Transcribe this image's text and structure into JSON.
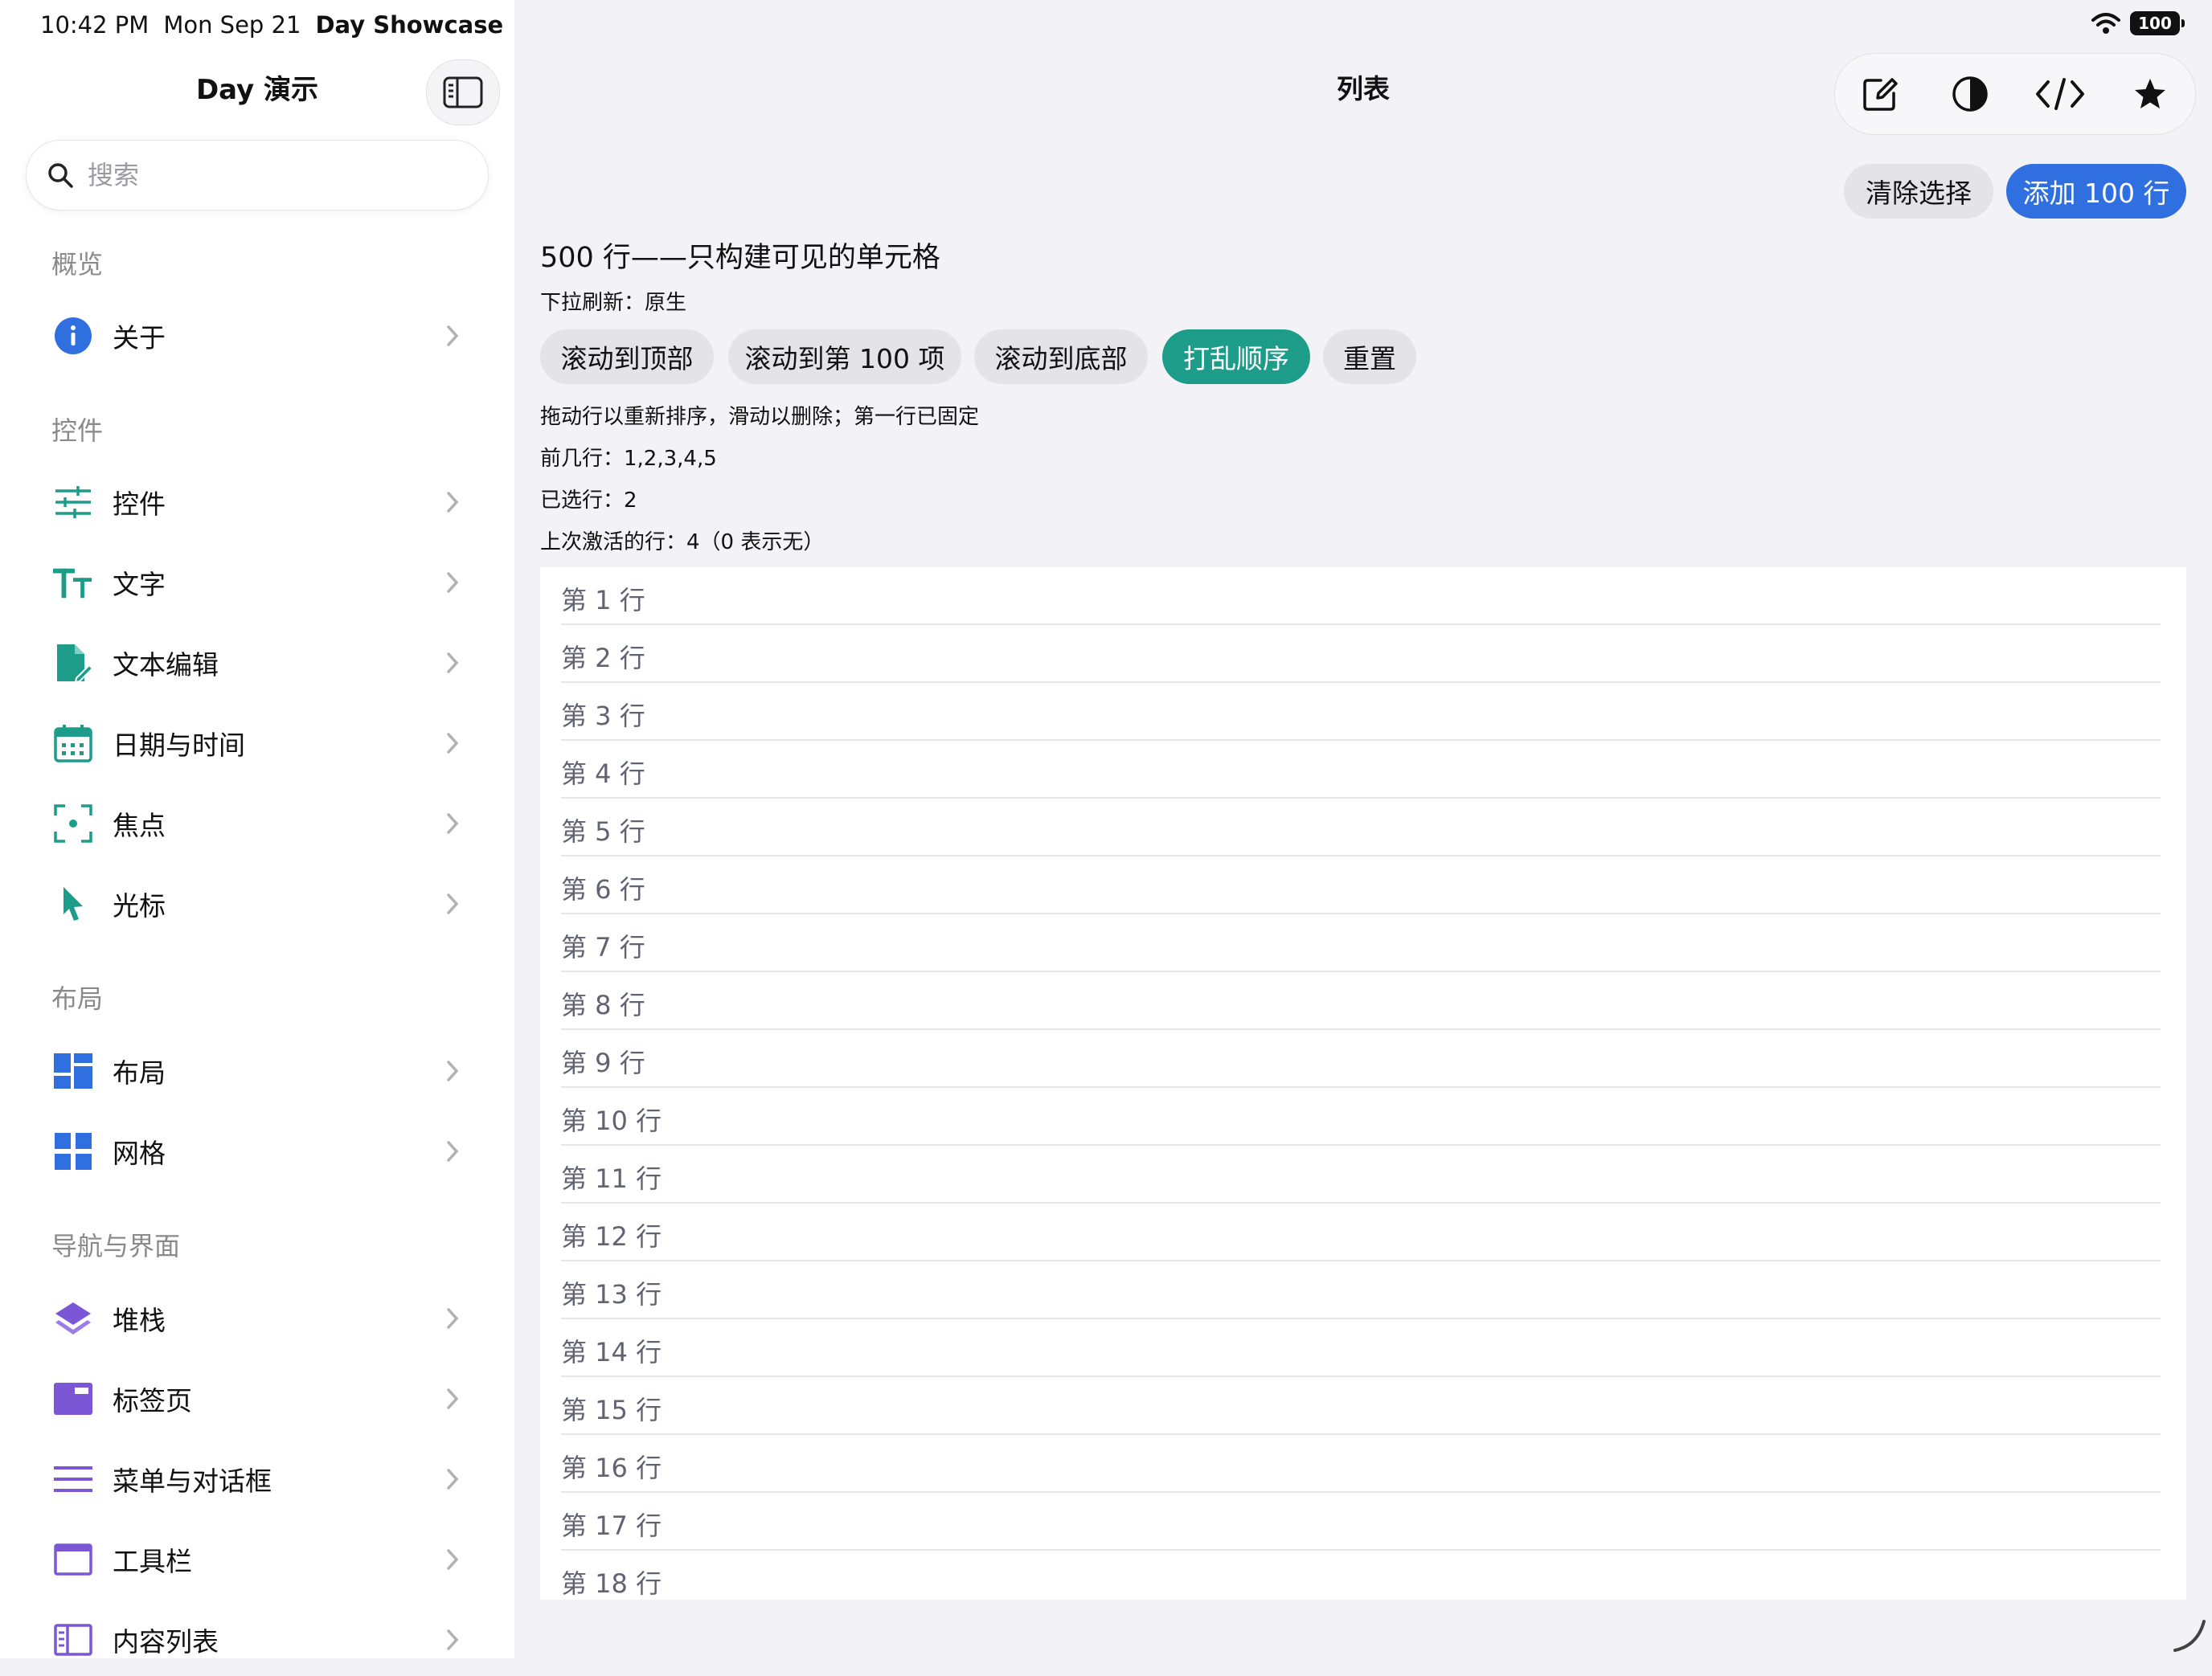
{
  "status": {
    "time": "10:42 PM",
    "date": "Mon Sep 21",
    "app": "Day Showcase",
    "battery": "100"
  },
  "sidebar": {
    "title": "Day 演示",
    "search_placeholder": "搜索",
    "sections": [
      {
        "label": "概览",
        "items": [
          {
            "label": "关于",
            "icon": "info-circle-icon",
            "color": "#2f6fe0"
          }
        ]
      },
      {
        "label": "控件",
        "items": [
          {
            "label": "控件",
            "icon": "sliders-icon",
            "color": "#1e9c8a"
          },
          {
            "label": "文字",
            "icon": "text-size-icon",
            "color": "#1e9c8a"
          },
          {
            "label": "文本编辑",
            "icon": "document-edit-icon",
            "color": "#1e9c8a"
          },
          {
            "label": "日期与时间",
            "icon": "calendar-icon",
            "color": "#1e9c8a"
          },
          {
            "label": "焦点",
            "icon": "focus-icon",
            "color": "#1e9c8a"
          },
          {
            "label": "光标",
            "icon": "cursor-icon",
            "color": "#1e9c8a"
          }
        ]
      },
      {
        "label": "布局",
        "items": [
          {
            "label": "布局",
            "icon": "layout-icon",
            "color": "#2f6fe0"
          },
          {
            "label": "网格",
            "icon": "grid-icon",
            "color": "#2f6fe0"
          }
        ]
      },
      {
        "label": "导航与界面",
        "items": [
          {
            "label": "堆栈",
            "icon": "stack-icon",
            "color": "#7b57d6"
          },
          {
            "label": "标签页",
            "icon": "tabs-icon",
            "color": "#7b57d6"
          },
          {
            "label": "菜单与对话框",
            "icon": "menu-icon",
            "color": "#7b57d6"
          },
          {
            "label": "工具栏",
            "icon": "toolbar-icon",
            "color": "#7b57d6"
          },
          {
            "label": "内容列表",
            "icon": "content-list-icon",
            "color": "#7b57d6"
          }
        ]
      }
    ]
  },
  "main": {
    "title": "列表",
    "toolbar_icons": [
      "compose-icon",
      "contrast-icon",
      "code-icon",
      "star-icon"
    ],
    "clear_selection": "清除选择",
    "add_rows": "添加 100 行",
    "heading": "500 行——只构建可见的单元格",
    "pull_refresh": "下拉刷新：原生",
    "actions": [
      "滚动到顶部",
      "滚动到第 100 项",
      "滚动到底部",
      "打乱顺序",
      "重置"
    ],
    "hint": "拖动行以重新排序，滑动以删除；第一行已固定",
    "first_rows": "前几行：1,2,3,4,5",
    "selected_rows": "已选行：2",
    "last_activated": "上次激活的行：4（0 表示无）",
    "rows": [
      "第 1 行",
      "第 2 行",
      "第 3 行",
      "第 4 行",
      "第 5 行",
      "第 6 行",
      "第 7 行",
      "第 8 行",
      "第 9 行",
      "第 10 行",
      "第 11 行",
      "第 12 行",
      "第 13 行",
      "第 14 行",
      "第 15 行",
      "第 16 行",
      "第 17 行",
      "第 18 行"
    ]
  },
  "colors": {
    "accent_blue": "#2f6fe0",
    "accent_teal": "#1e9c8a",
    "accent_purple": "#7b57d6"
  }
}
